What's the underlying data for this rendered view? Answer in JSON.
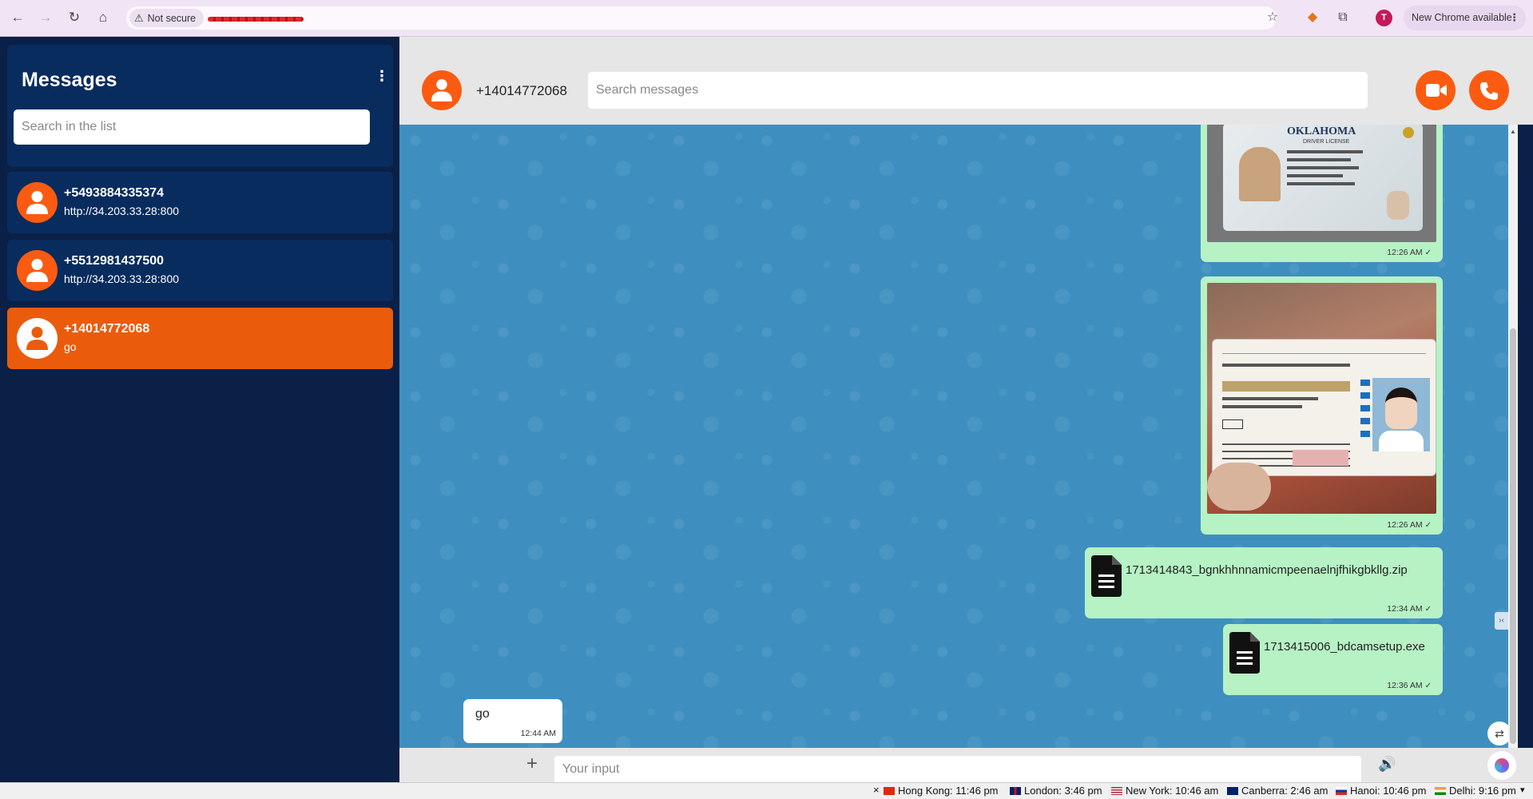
{
  "browser": {
    "security_label": "Not secure",
    "update_label": "New Chrome available",
    "profile_initial": "T"
  },
  "sidebar": {
    "title": "Messages",
    "search_placeholder": "Search in the list",
    "contacts": [
      {
        "number": "+5493884335374",
        "preview": "http://34.203.33.28:800",
        "active": false
      },
      {
        "number": "+5512981437500",
        "preview": "http://34.203.33.28:800",
        "active": false
      },
      {
        "number": "+14014772068",
        "preview": "go",
        "active": true
      }
    ]
  },
  "chat": {
    "contact_number": "+14014772068",
    "search_placeholder": "Search messages",
    "messages": [
      {
        "type": "image",
        "direction": "out",
        "time": "12:26 AM"
      },
      {
        "type": "image",
        "direction": "out",
        "time": "12:26 AM"
      },
      {
        "type": "file",
        "direction": "out",
        "filename": "1713414843_bgnkhhnnamicmpeenaelnjfhikgbkllg.zip",
        "time": "12:34 AM"
      },
      {
        "type": "file",
        "direction": "out",
        "filename": "1713415006_bdcamsetup.exe",
        "time": "12:36 AM"
      },
      {
        "type": "text",
        "direction": "in",
        "text": "go",
        "time": "12:44 AM"
      }
    ],
    "input_placeholder": "Your input"
  },
  "photo_text": {
    "license_state": "OKLAHOMA",
    "license_type": "DRIVER LICENSE"
  },
  "statusbar": {
    "clocks": [
      {
        "city": "Hong Kong: 11:46 pm"
      },
      {
        "city": "London: 3:46 pm"
      },
      {
        "city": "New York: 10:46 am"
      },
      {
        "city": "Canberra: 2:46 am"
      },
      {
        "city": "Hanoi: 10:46 pm"
      },
      {
        "city": "Delhi: 9:16 pm"
      }
    ]
  },
  "colors": {
    "accent": "#fb5b10",
    "sidebar_bg": "#0b2046",
    "chat_bg": "#3e8fc0",
    "bubble_out": "#b6f2c4"
  }
}
